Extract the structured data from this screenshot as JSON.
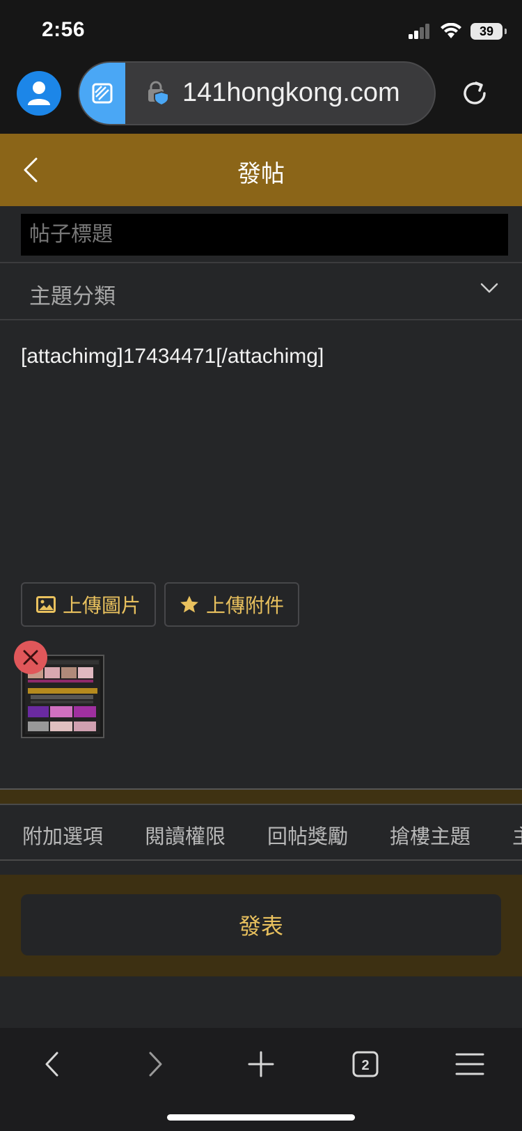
{
  "status": {
    "time": "2:56",
    "battery": "39"
  },
  "browser": {
    "url": "141hongkong.com",
    "tab_count": "2"
  },
  "header": {
    "title": "發帖"
  },
  "form": {
    "title_placeholder": "帖子標題",
    "category_label": "主題分類",
    "content": "[attachimg]17434471[/attachimg]"
  },
  "upload": {
    "image_label": "上傳圖片",
    "file_label": "上傳附件"
  },
  "tabs": [
    {
      "label": "附加選項"
    },
    {
      "label": "閱讀權限"
    },
    {
      "label": "回帖獎勵"
    },
    {
      "label": "搶樓主題"
    },
    {
      "label": "主"
    }
  ],
  "submit": {
    "label": "發表"
  },
  "colors": {
    "header": "#8b6518",
    "accent": "#e9c15e",
    "remove": "#e0575a",
    "link_blue": "#1c86e8"
  },
  "icons": [
    "profile-icon",
    "tab-icon",
    "lock-shield-icon",
    "reload-icon",
    "back-chevron-icon",
    "chevron-down-icon",
    "image-icon",
    "star-icon",
    "close-icon",
    "forward-icon",
    "plus-icon",
    "tabs-icon",
    "menu-icon"
  ]
}
